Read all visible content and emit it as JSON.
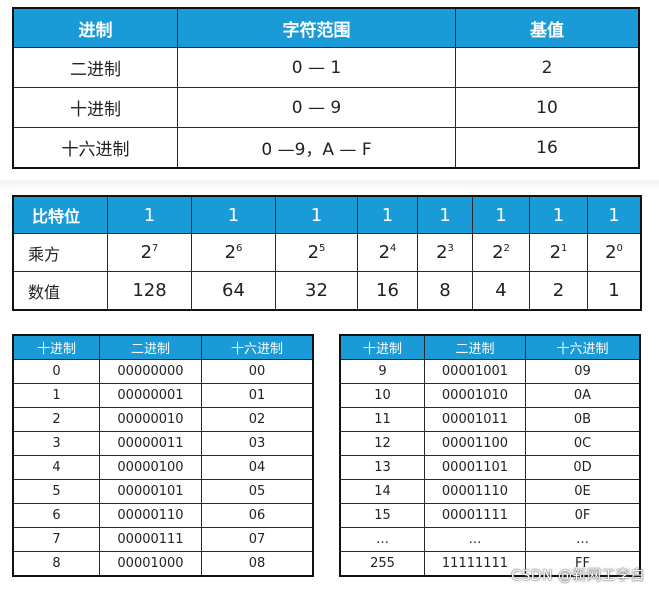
{
  "base_table": {
    "headers": [
      "进制",
      "字符范围",
      "基值"
    ],
    "rows": [
      [
        "二进制",
        "0 — 1",
        "2"
      ],
      [
        "十进制",
        "0 — 9",
        "10"
      ],
      [
        "十六进制",
        "0 —9，A — F",
        "16"
      ]
    ]
  },
  "bit_table": {
    "row_label_bits": "比特位",
    "bits": [
      "1",
      "1",
      "1",
      "1",
      "1",
      "1",
      "1",
      "1"
    ],
    "row_label_power": "乘方",
    "power_base": "2",
    "exponents": [
      "7",
      "6",
      "5",
      "4",
      "3",
      "2",
      "1",
      "0"
    ],
    "row_label_value": "数值",
    "values": [
      "128",
      "64",
      "32",
      "16",
      "8",
      "4",
      "2",
      "1"
    ]
  },
  "conv_table_left": {
    "headers": [
      "十进制",
      "二进制",
      "十六进制"
    ],
    "rows": [
      [
        "0",
        "00000000",
        "00"
      ],
      [
        "1",
        "00000001",
        "01"
      ],
      [
        "2",
        "00000010",
        "02"
      ],
      [
        "3",
        "00000011",
        "03"
      ],
      [
        "4",
        "00000100",
        "04"
      ],
      [
        "5",
        "00000101",
        "05"
      ],
      [
        "6",
        "00000110",
        "06"
      ],
      [
        "7",
        "00000111",
        "07"
      ],
      [
        "8",
        "00001000",
        "08"
      ]
    ]
  },
  "conv_table_right": {
    "headers": [
      "十进制",
      "二进制",
      "十六进制"
    ],
    "rows": [
      [
        "9",
        "00001001",
        "09"
      ],
      [
        "10",
        "00001010",
        "0A"
      ],
      [
        "11",
        "00001011",
        "0B"
      ],
      [
        "12",
        "00001100",
        "0C"
      ],
      [
        "13",
        "00001101",
        "0D"
      ],
      [
        "14",
        "00001110",
        "0E"
      ],
      [
        "15",
        "00001111",
        "0F"
      ],
      [
        "…",
        "…",
        "…"
      ],
      [
        "255",
        "11111111",
        "FF"
      ]
    ]
  },
  "watermark": "CSDN @新网工李白"
}
